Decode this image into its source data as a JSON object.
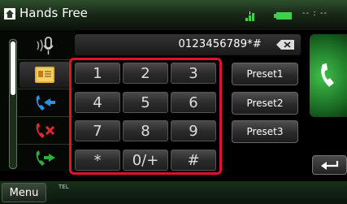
{
  "header": {
    "title": "Hands Free",
    "status_text": "-- : --"
  },
  "display": {
    "number": "0123456789*#"
  },
  "keypad": {
    "keys": [
      "1",
      "2",
      "3",
      "4",
      "5",
      "6",
      "7",
      "8",
      "9",
      "*",
      "0/+",
      "#"
    ]
  },
  "presets": [
    "Preset1",
    "Preset2",
    "Preset3"
  ],
  "footer": {
    "menu_label": "Menu",
    "source_label": "TEL"
  },
  "colors": {
    "accent_green": "#2fae3c",
    "highlight_red": "#e0112b",
    "recent_blue": "#2a93e0",
    "missed_red": "#e02a2a"
  },
  "icons": {
    "home": "house-icon",
    "signal": "signal-icon",
    "battery": "battery-icon",
    "voice": "voice-recognition-icon",
    "phonebook": "phonebook-icon",
    "incoming": "incoming-calls-icon",
    "missed": "missed-calls-icon",
    "outgoing": "outgoing-calls-icon",
    "backspace": "backspace-icon",
    "call": "call-icon",
    "return": "return-icon"
  }
}
